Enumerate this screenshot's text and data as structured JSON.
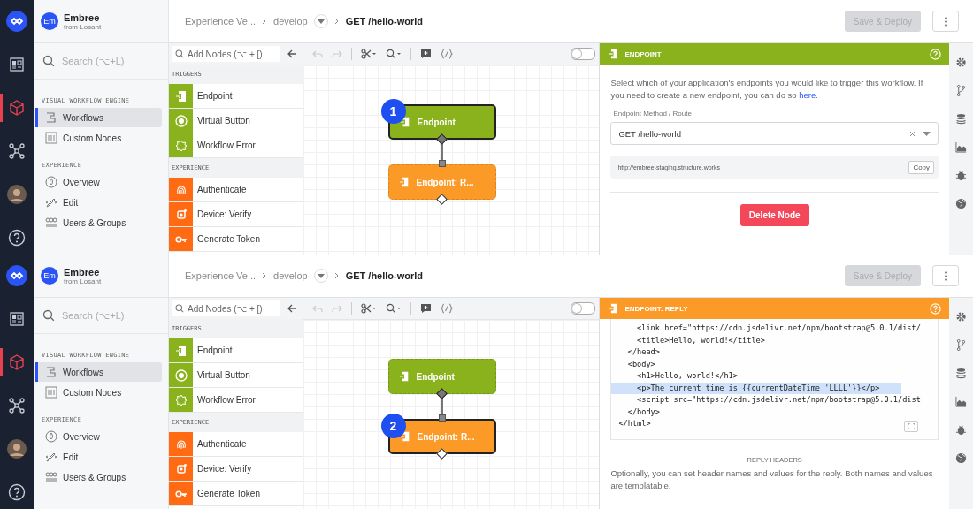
{
  "panels": [
    {
      "rail": [
        {
          "selected": false
        },
        {
          "selected": false
        },
        {
          "selected": true
        },
        {
          "selected": false
        },
        {
          "selected": false
        },
        {
          "selected": false
        }
      ],
      "org": {
        "initials": "Em",
        "name": "Embree",
        "subtitle": "from Losant"
      },
      "search": {
        "placeholder": "Search (⌥+L)"
      },
      "nav": [
        {
          "heading": "VISUAL WORKFLOW ENGINE",
          "items": [
            {
              "label": "Workflows",
              "selected": true
            },
            {
              "label": "Custom Nodes",
              "selected": false
            }
          ]
        },
        {
          "heading": "EXPERIENCE",
          "items": [
            {
              "label": "Overview",
              "selected": false
            },
            {
              "label": "Edit",
              "selected": false
            },
            {
              "label": "Users & Groups",
              "selected": false
            }
          ]
        }
      ],
      "breadcrumb": {
        "application": "Experience Ve...",
        "version": "develop",
        "workflow": "GET /hello-world"
      },
      "save_button": {
        "label": "Save & Deploy",
        "disabled": true
      },
      "palette": {
        "placeholder": "Add Nodes (⌥ + [)",
        "groups": [
          {
            "heading": "TRIGGERS",
            "kind": "trigger",
            "items": [
              "Endpoint",
              "Virtual Button",
              "Workflow Error"
            ]
          },
          {
            "heading": "EXPERIENCE",
            "kind": "experience",
            "items": [
              "Authenticate",
              "Device: Verify",
              "Generate Token"
            ]
          }
        ]
      },
      "toolbar": {
        "toggle_on": false
      },
      "canvas": {
        "callout": "1",
        "nodes": [
          {
            "label": "Endpoint",
            "kind": "trigger",
            "selected": true
          },
          {
            "label": "Endpoint: R...",
            "kind": "experience",
            "selected": false
          }
        ]
      },
      "inspector": {
        "kind": "trigger",
        "title": "ENDPOINT",
        "content": {
          "kind": "endpoint",
          "description": "Select which of your application's endpoints you would like to trigger this workflow. If you need to create a new endpoint, you can do so ",
          "link": "here",
          "description_end": ".",
          "field_label": "Endpoint Method / Route",
          "field_value": "GET /hello-world",
          "url": "http://embree-staging.structure.works",
          "copy_label": "Copy",
          "delete_label": "Delete Node"
        }
      }
    },
    {
      "rail": [
        {
          "selected": false
        },
        {
          "selected": false
        },
        {
          "selected": true
        },
        {
          "selected": false
        },
        {
          "selected": false
        },
        {
          "selected": false
        }
      ],
      "org": {
        "initials": "Em",
        "name": "Embree",
        "subtitle": "from Losant"
      },
      "search": {
        "placeholder": "Search (⌥+L)"
      },
      "nav": [
        {
          "heading": "VISUAL WORKFLOW ENGINE",
          "items": [
            {
              "label": "Workflows",
              "selected": true
            },
            {
              "label": "Custom Nodes",
              "selected": false
            }
          ]
        },
        {
          "heading": "EXPERIENCE",
          "items": [
            {
              "label": "Overview",
              "selected": false
            },
            {
              "label": "Edit",
              "selected": false
            },
            {
              "label": "Users & Groups",
              "selected": false
            }
          ]
        }
      ],
      "breadcrumb": {
        "application": "Experience Ve...",
        "version": "develop",
        "workflow": "GET /hello-world"
      },
      "save_button": {
        "label": "Save & Deploy",
        "disabled": true
      },
      "palette": {
        "placeholder": "Add Nodes (⌥ + [)",
        "groups": [
          {
            "heading": "TRIGGERS",
            "kind": "trigger",
            "items": [
              "Endpoint",
              "Virtual Button",
              "Workflow Error"
            ]
          },
          {
            "heading": "EXPERIENCE",
            "kind": "experience",
            "items": [
              "Authenticate",
              "Device: Verify",
              "Generate Token"
            ]
          }
        ]
      },
      "toolbar": {
        "toggle_on": false
      },
      "canvas": {
        "callout": "2",
        "nodes": [
          {
            "label": "Endpoint",
            "kind": "trigger",
            "selected": false
          },
          {
            "label": "Endpoint: R...",
            "kind": "experience",
            "selected": true
          }
        ]
      },
      "inspector": {
        "kind": "experience",
        "title": "ENDPOINT: REPLY",
        "content": {
          "kind": "reply",
          "code": [
            {
              "text": "    <link href=\"https://cdn.jsdelivr.net/npm/bootstrap@5.0.1/dist/",
              "selected": false
            },
            {
              "text": "    <title>Hello, world!</title>",
              "selected": false
            },
            {
              "text": "  </head>",
              "selected": false
            },
            {
              "text": "  <body>",
              "selected": false
            },
            {
              "text": "    <h1>Hello, world!</h1>",
              "selected": false
            },
            {
              "text": "    <p>The current time is {{currentDateTime 'LLLL'}}</p>",
              "selected": true
            },
            {
              "text": "    <script src=\"https://cdn.jsdelivr.net/npm/bootstrap@5.0.1/dist",
              "selected": false
            },
            {
              "text": "  </body>",
              "selected": false
            },
            {
              "text": "</html>",
              "selected": false
            }
          ],
          "section": "REPLY HEADERS",
          "description": "Optionally, you can set header names and values for the reply. Both names and values are templatable."
        }
      }
    }
  ]
}
